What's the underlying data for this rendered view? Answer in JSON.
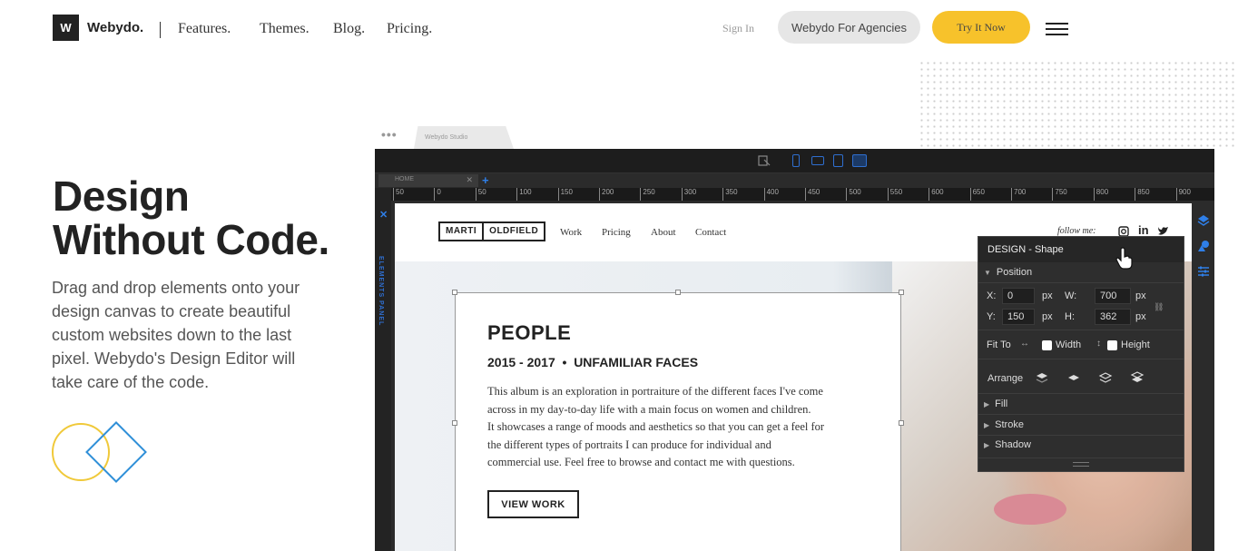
{
  "header": {
    "logo_letter": "W",
    "brand": "Webydo.",
    "nav": [
      "Features.",
      "Themes.",
      "Blog.",
      "Pricing."
    ],
    "signin": "Sign In",
    "agency_button": "Webydo For Agencies",
    "cta_button": "Try It Now"
  },
  "hero": {
    "headline_line1": "Design",
    "headline_line2": "Without Code.",
    "description": "Drag and drop elements onto your design canvas to create beautiful custom websites down to the last pixel. Webydo's Design Editor will take care of the code."
  },
  "editor": {
    "window_tab": "Webydo Studio",
    "page_tab": "HOME",
    "elements_panel_label": "ELEMENTS PANEL",
    "ruler": [
      "50",
      "0",
      "50",
      "100",
      "150",
      "200",
      "250",
      "300",
      "350",
      "400",
      "450",
      "500",
      "550",
      "600",
      "650",
      "700",
      "750",
      "800",
      "850",
      "900"
    ],
    "site": {
      "logo_left": "MARTI",
      "logo_right": "OLDFIELD",
      "nav": [
        "Work",
        "Pricing",
        "About",
        "Contact"
      ],
      "follow": "follow me:",
      "title": "PEOPLE",
      "subtitle": "2015 - 2017  •  UNFAMILIAR FACES",
      "body_lines": [
        "This album is an exploration in portraiture of the different faces I've come",
        "across in my day-to-day life with a main focus on women and children.",
        "It showcases a range of moods and aesthetics so that you can get a feel for",
        "the different types of portraits I can produce for individual and",
        "commercial use. Feel free to browse and contact me with questions."
      ],
      "button": "VIEW WORK"
    },
    "design_panel": {
      "title": "DESIGN - Shape",
      "position_label": "Position",
      "x_label": "X:",
      "x_value": "0",
      "y_label": "Y:",
      "y_value": "150",
      "w_label": "W:",
      "w_value": "700",
      "h_label": "H:",
      "h_value": "362",
      "unit": "px",
      "fit_to": "Fit To",
      "width_label": "Width",
      "height_label": "Height",
      "arrange": "Arrange",
      "fill": "Fill",
      "stroke": "Stroke",
      "shadow": "Shadow"
    }
  },
  "colors": {
    "accent_yellow": "#f7c22b",
    "accent_blue": "#2f8fd8",
    "editor_bg": "#2b2b2b"
  }
}
